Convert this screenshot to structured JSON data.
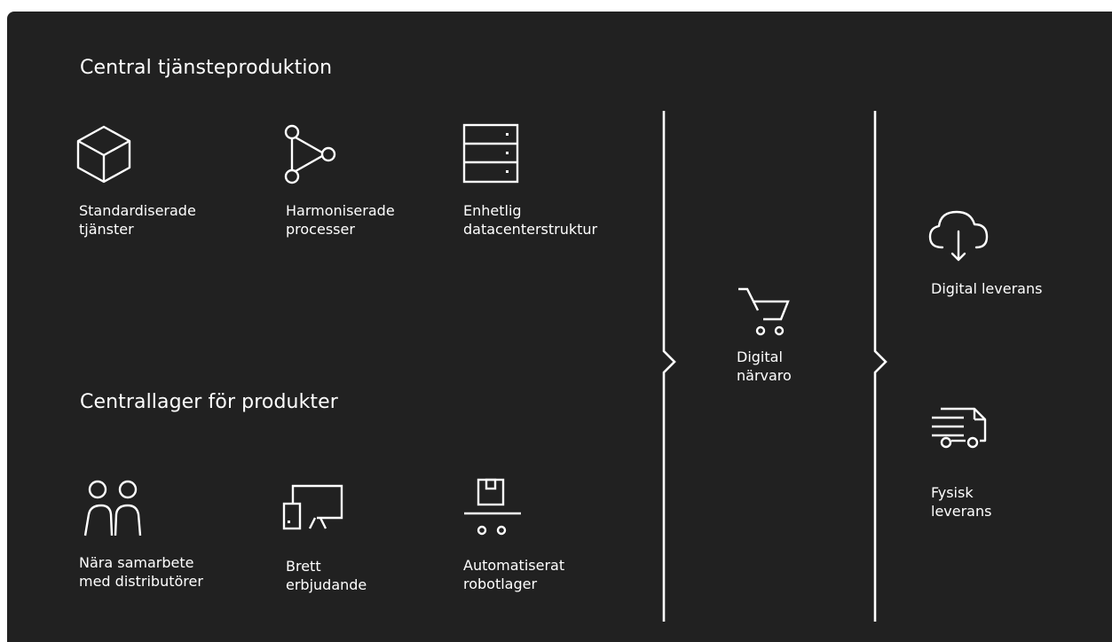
{
  "sections": {
    "services_title": "Central tjänsteproduktion",
    "products_title": "Centrallager för produkter"
  },
  "services": [
    {
      "icon": "cube-icon",
      "label": "Standardiserade\ntjänster"
    },
    {
      "icon": "process-nodes-icon",
      "label": "Harmoniserade\nprocesser"
    },
    {
      "icon": "server-rack-icon",
      "label": "Enhetlig\ndatacenterstruktur"
    }
  ],
  "products": [
    {
      "icon": "people-icon",
      "label": "Nära samarbete\nmed distributörer"
    },
    {
      "icon": "presentation-board-icon",
      "label": "Brett\nerbjudande"
    },
    {
      "icon": "conveyor-box-icon",
      "label": "Automatiserat\nrobotlager"
    }
  ],
  "middle": {
    "icon": "shopping-cart-icon",
    "label": "Digital\nnärvaro"
  },
  "delivery": [
    {
      "icon": "cloud-download-icon",
      "label": "Digital leverans"
    },
    {
      "icon": "delivery-truck-icon",
      "label": "Fysisk\nleverans"
    }
  ],
  "colors": {
    "background": "#212121",
    "foreground": "#ffffff"
  }
}
